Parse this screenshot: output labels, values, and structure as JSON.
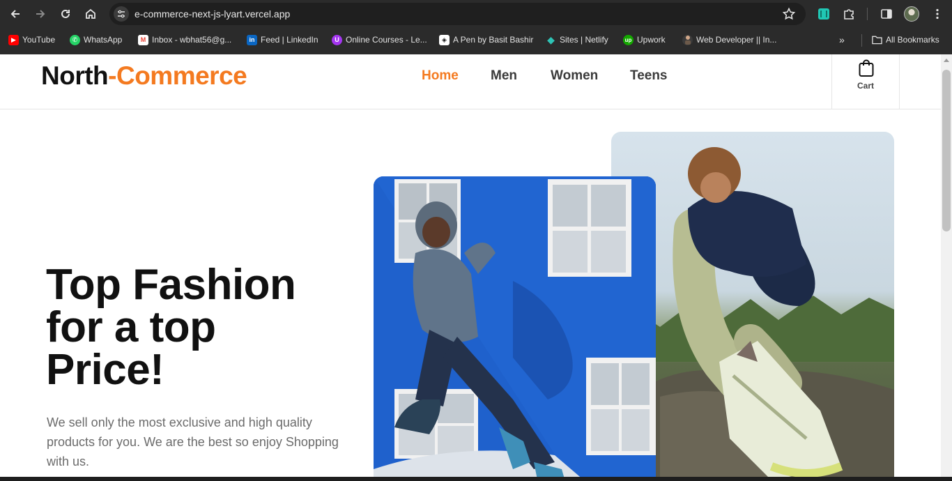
{
  "browser": {
    "url": "e-commerce-next-js-lyart.vercel.app",
    "bookmarks": [
      {
        "label": "YouTube",
        "icon": "youtube-icon",
        "color": "#ff0000"
      },
      {
        "label": "WhatsApp",
        "icon": "whatsapp-icon",
        "color": "#25d366"
      },
      {
        "label": "Inbox - wbhat56@g...",
        "icon": "gmail-icon",
        "color": "#ea4335"
      },
      {
        "label": "Feed | LinkedIn",
        "icon": "linkedin-icon",
        "color": "#0a66c2"
      },
      {
        "label": "Online Courses - Le...",
        "icon": "udemy-icon",
        "color": "#a435f0"
      },
      {
        "label": "A Pen by Basit Bashir",
        "icon": "codepen-icon",
        "color": "#ffffff"
      },
      {
        "label": "Sites | Netlify",
        "icon": "netlify-icon",
        "color": "#2ec4b6"
      },
      {
        "label": "Upwork",
        "icon": "upwork-icon",
        "color": "#14a800"
      },
      {
        "label": "Web Developer || In...",
        "icon": "person-icon",
        "color": "#8a7060"
      }
    ],
    "all_bookmarks": "All Bookmarks"
  },
  "site": {
    "logo_part1": "North",
    "logo_part2": "-Commerce",
    "nav": [
      "Home",
      "Men",
      "Women",
      "Teens"
    ],
    "active_nav": "Home",
    "cart_label": "Cart",
    "accent_color": "#f47a20"
  },
  "hero": {
    "title_line1": "Top Fashion",
    "title_line2": "for a top",
    "title_line3": "Price!",
    "subtitle": "We sell only the most exclusive and high quality products for you. We are the best so enjoy Shopping with us."
  }
}
